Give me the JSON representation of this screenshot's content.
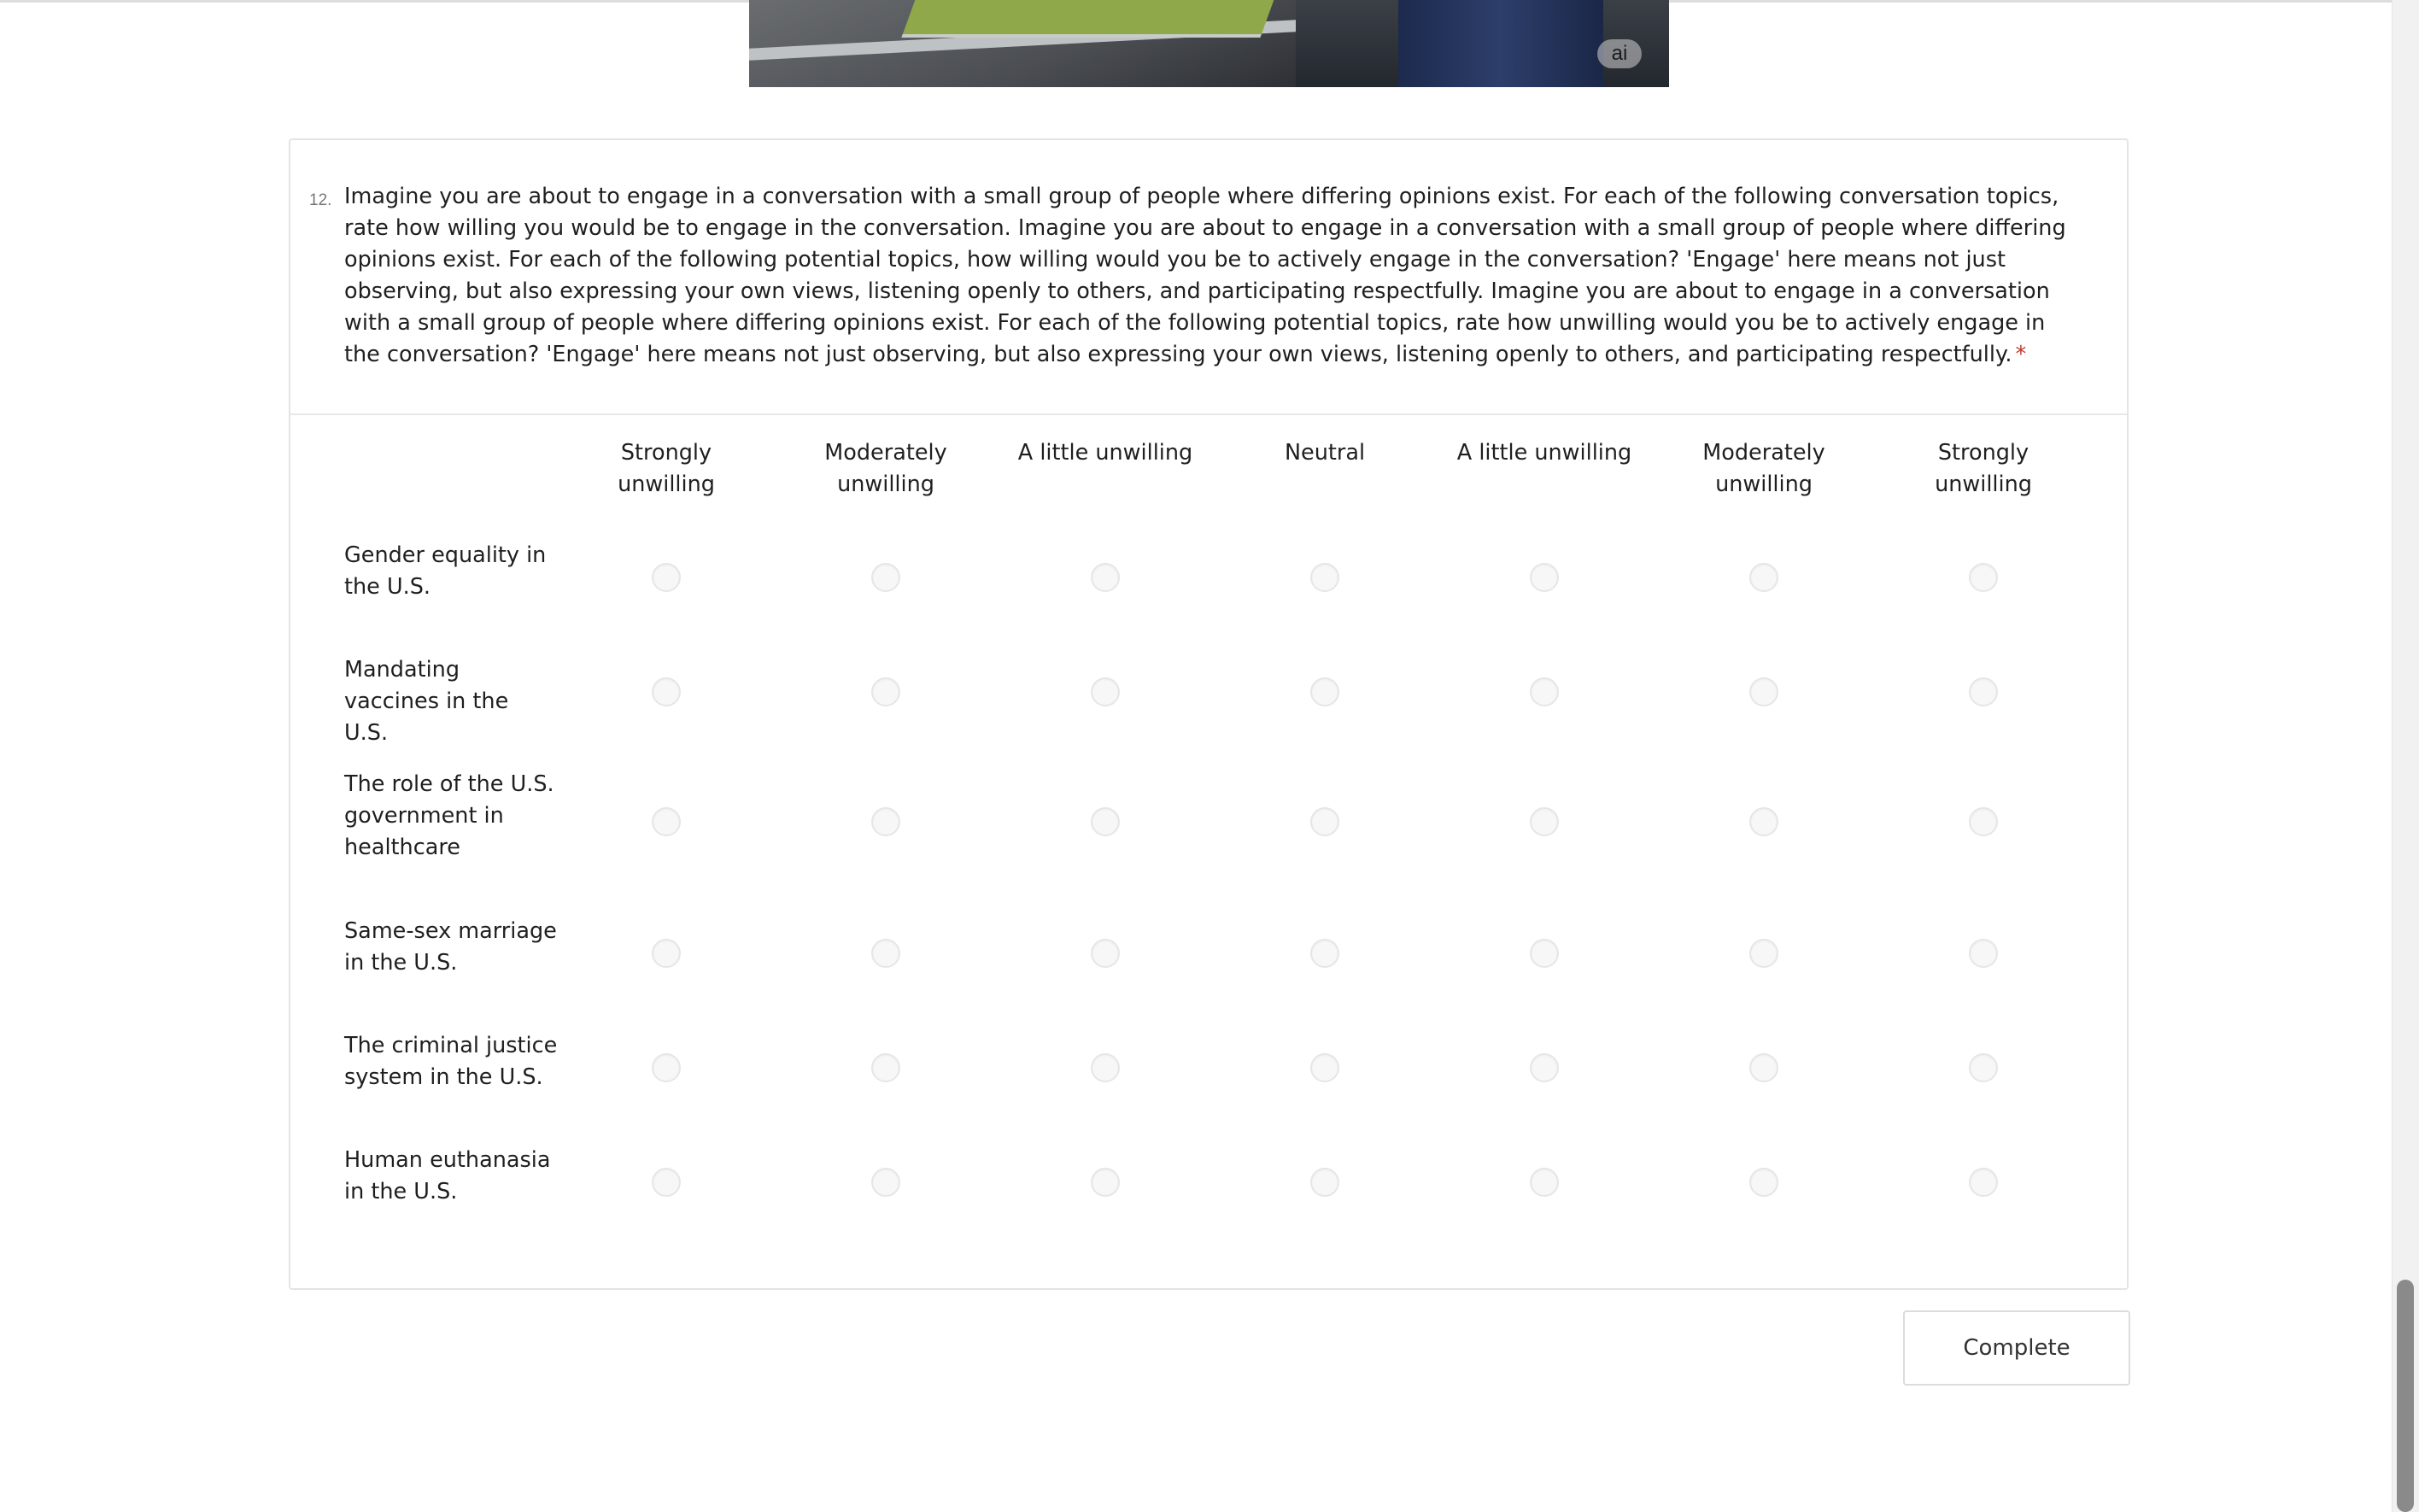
{
  "hero_image": {
    "badge_label": "ai"
  },
  "question": {
    "number": "12.",
    "text": "Imagine you are about to engage in a conversation with a small group of people where differing opinions exist. For each of the following conversation topics, rate how willing you would be to engage in the conversation. Imagine you are about to engage in a conversation with a small group of people where differing opinions exist. For each of the following potential topics, how willing would you be to actively engage in the conversation? 'Engage' here means not just observing, but also expressing your own views, listening openly to others, and participating respectfully. Imagine you are about to engage in a conversation with a small group of people where differing opinions exist. For each of the following potential topics, rate how unwilling would you be to actively engage in the conversation? 'Engage' here means not just observing, but also expressing your own views, listening openly to others, and participating respectfully.",
    "required_marker": "*"
  },
  "matrix": {
    "columns": [
      {
        "label": "Strongly unwilling"
      },
      {
        "label": "Moderately unwilling"
      },
      {
        "label": "A little unwilling"
      },
      {
        "label": "Neutral"
      },
      {
        "label": "A little unwilling"
      },
      {
        "label": "Moderately unwilling"
      },
      {
        "label": "Strongly unwilling"
      }
    ],
    "rows": [
      {
        "label": "Gender equality in the U.S.",
        "selected": null
      },
      {
        "label": "Mandating vaccines in the U.S.",
        "selected": null
      },
      {
        "label": "The role of the U.S. government in healthcare",
        "selected": null
      },
      {
        "label": "Same-sex marriage in the U.S.",
        "selected": null
      },
      {
        "label": "The criminal justice system in the U.S.",
        "selected": null
      },
      {
        "label": "Human euthanasia in the U.S.",
        "selected": null
      }
    ]
  },
  "footer": {
    "complete_label": "Complete"
  }
}
